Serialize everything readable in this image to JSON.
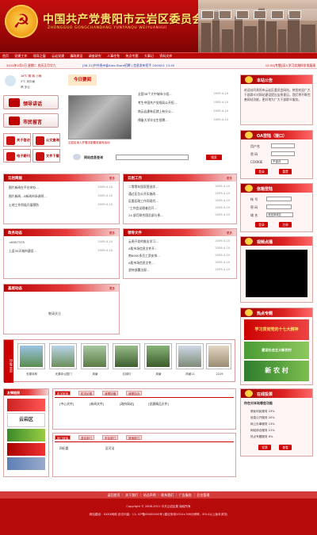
{
  "site": {
    "title": "中国共产党贵阳市云岩区委员会",
    "subtitle": "ZHONGGUO GONGCHANDANG YUNYANQU WEIYUANHUI"
  },
  "nav": [
    "首页",
    "党建工作",
    "领导之窗",
    "云岩党建",
    "廉政建设",
    "调查研究",
    "人事任免",
    "热点专题",
    "大事记",
    "资料文库"
  ],
  "ticker": {
    "date": "2011年2月1日 星期二 农历正月廿九",
    "news1": "党组织进驻  2009/01/13 A2",
    "news2": "[08-31]中共贵州省Area  Store招聘 | 信息发布招手 2009/01 13:45",
    "news3": "12:31[专题]深入学习实践科学发展观"
  },
  "weather": {
    "temp": "16℃ 阴 转 小雨",
    "temp2": "5℃ 风向南",
    "note": "晴 多云"
  },
  "left_buttons": {
    "leader": "领导讲话",
    "citizen": "市民留言",
    "mayor": "关于信访",
    "public": "公文查询",
    "mail": "电子期刊",
    "download": "文件下载"
  },
  "today": {
    "title": "今日要闻",
    "caption": "云岩区深入开展法制建设宣传活动",
    "items": [
      "全国38个大中城市小组...",
      "考生中国共产党规局公开招...",
      "南云岩建有区就上有分公...",
      "预备大学毕业生招聘..."
    ],
    "dates": [
      "2009-4-10",
      "2009-4-10",
      "2009-4-10",
      "2009-4-10"
    ]
  },
  "search": {
    "label": "网站信息查询",
    "placeholder": "",
    "button": "搜索"
  },
  "announce": {
    "title": "本站公告",
    "text": "欢迎访问贵阳市云岩区委员会网站，热忱欢迎广大干部群众对网站建设提出宝贵意见。我们将不断完善网站功能，更好地为广大干部群众服务。"
  },
  "oa": {
    "title": "OA登陆（接口）",
    "user": "用户名",
    "pass": "密 码",
    "cookie": "COOKIE",
    "cookie_opt": "不保存",
    "btn_login": "登录",
    "btn_reset": "重置"
  },
  "mail": {
    "title": "信箱登陆",
    "name": "帐 号",
    "pwd": "密 码",
    "domain": "域 名",
    "domain_opt": "请选择域名",
    "btn1": "登录",
    "btn2": "注册"
  },
  "video": {
    "title": "视频点播"
  },
  "hot": {
    "title": "热点专题",
    "banner1": "学习贯彻党的十七大精神",
    "banner2": "建设社会主义新农村",
    "banner3": "新 农 村"
  },
  "survey": {
    "title": "在线投票",
    "question": "你在对本站哪些功能",
    "opts": [
      "便民利民服务 23%",
      "信息公开服务 20%",
      "网上办事服务 13%",
      "网站综合服务 21%",
      "热点专题服务 6%"
    ],
    "b1": "投票",
    "b2": "查看"
  },
  "sec1": {
    "title": "云岩简报",
    "more": "更多",
    "items": [
      "图片新闻在平台举办...",
      "图片新闻…5新闻市场说明...",
      "土地工作积极开展预防"
    ],
    "dates": [
      "2009-4-10",
      "2009-4-10",
      "2009-4-10"
    ]
  },
  "sec2": {
    "title": "云岩工作",
    "more": "更多",
    "items": [
      "二零零年国家营选学...",
      "通过区位公开实施改...",
      "区委区政工作同现代...",
      "“工作会议理者召开...",
      "24 部月联合国总部与贵..."
    ],
    "dates": [
      "2009-4-10",
      "2009-4-10",
      "2009-4-10",
      "2009-4-10",
      "2009-4-10"
    ]
  },
  "sec3": {
    "title": "政务动态",
    "more": "更多",
    "items": [
      "<6557375",
      "上县30天城市建设..."
    ],
    "dates": [
      "2009-4-10",
      "2009-4-10"
    ]
  },
  "sec4": {
    "title": "领导文件",
    "more": "更多",
    "items": [
      "云贵开发的推出学习...",
      "A股市场信息文件开...",
      "南6000多员工资安排...",
      "A股市场信息文件...",
      "坚持部署法规..."
    ],
    "dates": [
      "2009-4-10",
      "2009-4-10",
      "2009-4-10",
      "2009-4-10",
      "2009-4-10"
    ]
  },
  "sec5": {
    "title": "基层动态",
    "more": "更多",
    "empty": "敬请关注"
  },
  "gallery": {
    "side": "印象云岩",
    "caps": [
      "天源寺林",
      "天源寺公园门",
      "风景",
      "红绿灯",
      "风景",
      "风景11",
      "2229"
    ]
  },
  "bottom_left": {
    "title": "友情链接",
    "name1": "云岩区"
  },
  "tabs1": [
    "机关推荐",
    "机关纪委",
    "我是协管",
    "我是协办"
  ],
  "tabs1_cols": [
    "[中心文件]",
    "[新闻文件]",
    "[政府网站]",
    "[党建精品文件]"
  ],
  "tabs2": [
    "部门链接",
    "县区部门",
    "市区部门",
    "其他部门"
  ],
  "tabs2_items": [
    "四纪委",
    "区司法"
  ],
  "footer": {
    "nav": "返回首页 ｜ 关于我们 ｜ 站点声明 ｜ 联系我们 ｜ 广告服务 ｜ 后台管理",
    "line1": "Copyright © 2008-2011 中共云岩区委 版权所有",
    "line2": "网站建设：XXXX网络      总访问量：1人   ICP备09000000号   (建议采用1024×768分辨率，IE5.0以上版本浏览)"
  },
  "colors": {
    "primary": "#b80808",
    "accent": "#ffe36b"
  }
}
